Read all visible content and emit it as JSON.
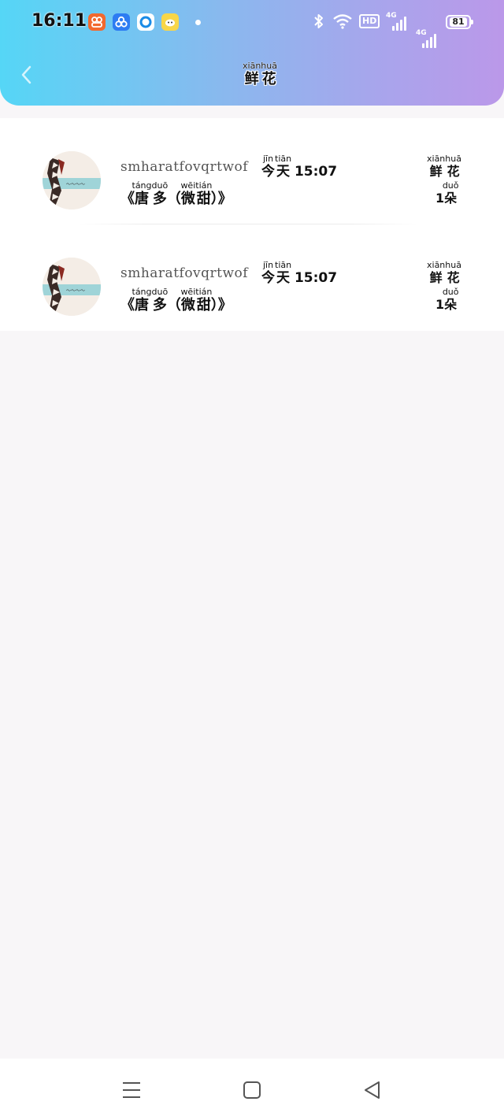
{
  "status_bar": {
    "time": "16:11",
    "network_label": "4G",
    "hd_label": "HD",
    "battery": "81"
  },
  "header": {
    "title_hanzi": [
      "鲜",
      "花"
    ],
    "title_pinyin": [
      "xiān",
      "huā"
    ]
  },
  "gift_list": [
    {
      "username": "smharatfovqrtwof",
      "time_hanzi": [
        "今",
        "天"
      ],
      "time_pinyin": [
        "jīn",
        "tiān"
      ],
      "time_clock": "15:07",
      "gift_hanzi": [
        "鲜",
        "花"
      ],
      "gift_pinyin": [
        "xiān",
        "huā"
      ],
      "book_open": "《",
      "book_hanzi": [
        "唐",
        "多"
      ],
      "book_pinyin": [
        "táng",
        "duō"
      ],
      "book_paren_open": "（",
      "book_tag_hanzi": [
        "微",
        "甜"
      ],
      "book_tag_pinyin": [
        "wēi",
        "tián"
      ],
      "book_paren_close": "）",
      "book_close": "》",
      "count_number": "1",
      "count_hanzi": "朵",
      "count_pinyin": "duǒ"
    },
    {
      "username": "smharatfovqrtwof",
      "time_hanzi": [
        "今",
        "天"
      ],
      "time_pinyin": [
        "jīn",
        "tiān"
      ],
      "time_clock": "15:07",
      "gift_hanzi": [
        "鲜",
        "花"
      ],
      "gift_pinyin": [
        "xiān",
        "huā"
      ],
      "book_open": "《",
      "book_hanzi": [
        "唐",
        "多"
      ],
      "book_pinyin": [
        "táng",
        "duō"
      ],
      "book_paren_open": "（",
      "book_tag_hanzi": [
        "微",
        "甜"
      ],
      "book_tag_pinyin": [
        "wēi",
        "tián"
      ],
      "book_paren_close": "）",
      "book_close": "》",
      "count_number": "1",
      "count_hanzi": "朵",
      "count_pinyin": "duǒ"
    }
  ],
  "colors": {
    "header_gradient_start": "#55d6f6",
    "header_gradient_end": "#bb98e9",
    "page_background": "#f8f6f8"
  },
  "icons": {
    "back": "chevron-left-icon",
    "nav_menu": "menu-icon",
    "nav_home": "home-square-icon",
    "nav_back": "triangle-back-icon"
  }
}
